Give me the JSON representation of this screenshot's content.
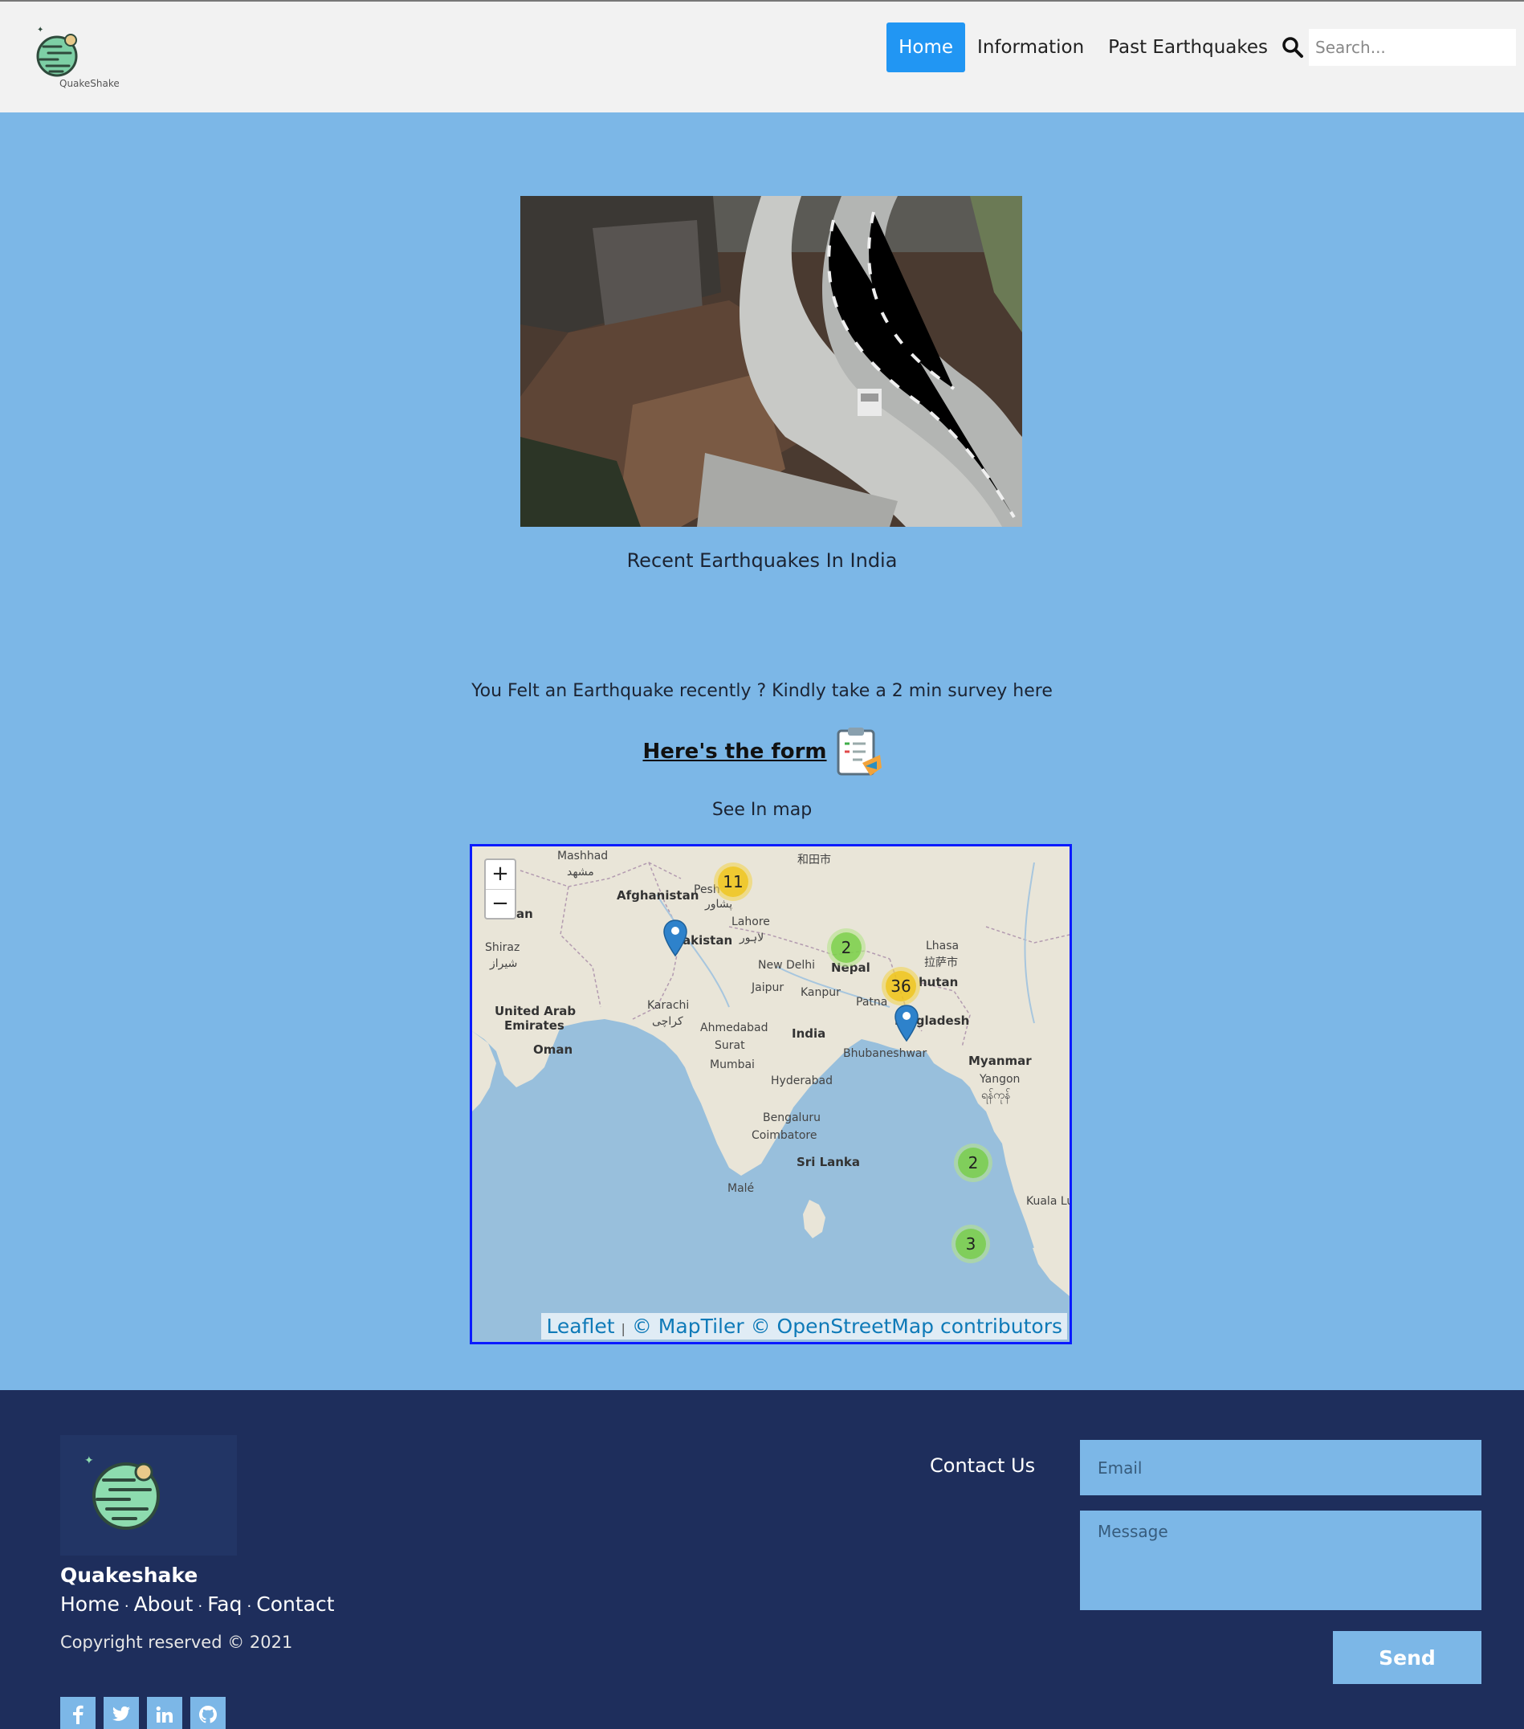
{
  "header": {
    "logo_text": "QuakeShake",
    "nav": [
      {
        "label": "Home",
        "active": true
      },
      {
        "label": "Information",
        "active": false
      },
      {
        "label": "Past Earthquakes",
        "active": false
      }
    ],
    "search_placeholder": "Search..."
  },
  "main": {
    "hero_caption": "Recent Earthquakes In India",
    "survey_text": "You Felt an Earthquake recently ? Kindly take a 2 min survey here",
    "form_link": "Here's the form",
    "see_map": "See In map"
  },
  "map": {
    "zoom_in": "+",
    "zoom_out": "−",
    "clusters": [
      {
        "count": "11",
        "kind": "med"
      },
      {
        "count": "2",
        "kind": "small"
      },
      {
        "count": "36",
        "kind": "med"
      },
      {
        "count": "2",
        "kind": "small"
      },
      {
        "count": "3",
        "kind": "small"
      }
    ],
    "labels": {
      "mashhad": "Mashhad",
      "mashhad_fa": "مشهد",
      "hotan": "和田市",
      "afghanistan": "Afghanistan",
      "peshawar": "Pesh",
      "peshawar_ur": "پشاور",
      "lahore": "Lahore",
      "lahore_ur": "لاہور",
      "pakistan": "akistan",
      "iran": "an",
      "shiraz": "Shiraz",
      "shiraz_fa": "شیراز",
      "new_delhi": "New Delhi",
      "jaipur": "Jaipur",
      "kanpur": "Kanpur",
      "nepal": "Nepal",
      "lhasa": "Lhasa",
      "lhasa_cn": "拉萨市",
      "bhutan": "hutan",
      "patna": "Patna",
      "bangladesh": "Ba   gladesh",
      "uae": "United Arab",
      "uae2": "Emirates",
      "karachi": "Karachi",
      "karachi_ur": "کراچی",
      "ahmedabad": "Ahmedabad",
      "india": "India",
      "surat": "Surat",
      "oman": "Oman",
      "mumbai": "Mumbai",
      "bhubaneshwar": "Bhubaneshwar",
      "myanmar": "Myanmar",
      "yangon": "Yangon",
      "yangon_my": "ရန်ကုန်",
      "hyderabad": "Hyderabad",
      "bengaluru": "Bengaluru",
      "coimbatore": "Coimbatore",
      "sri_lanka": "Sri Lanka",
      "male": "Malé",
      "kuala": "Kuala Lu"
    },
    "attribution": {
      "leaflet": "Leaflet",
      "maptiler": "© MapTiler",
      "osm": "© OpenStreetMap contributors"
    }
  },
  "footer": {
    "brand": "Quakeshake",
    "links": [
      "Home",
      "About",
      "Faq",
      "Contact"
    ],
    "copyright": "Copyright reserved © 2021",
    "socials": [
      "f",
      "t",
      "in",
      "gh"
    ],
    "contact_title": "Contact Us",
    "email_placeholder": "Email",
    "message_placeholder": "Message",
    "send_label": "Send"
  }
}
